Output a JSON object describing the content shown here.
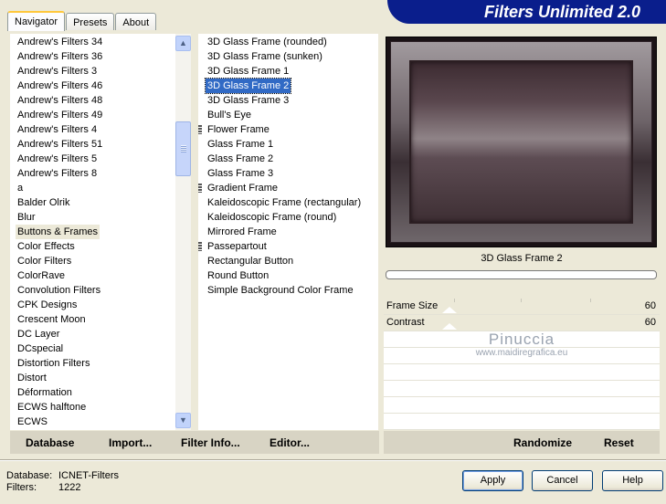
{
  "header": {
    "title": "Filters Unlimited 2.0"
  },
  "tabs": [
    {
      "label": "Navigator",
      "active": true
    },
    {
      "label": "Presets",
      "active": false
    },
    {
      "label": "About",
      "active": false
    }
  ],
  "categories": {
    "items": [
      "Andrew's Filters 34",
      "Andrew's Filters 36",
      "Andrew's Filters 3",
      "Andrew's Filters 46",
      "Andrew's Filters 48",
      "Andrew's Filters 49",
      "Andrew's Filters 4",
      "Andrew's Filters 51",
      "Andrew's Filters 5",
      "Andrew's Filters 8",
      "a",
      "Balder Olrik",
      "Blur",
      "Buttons & Frames",
      "Color Effects",
      "Color Filters",
      "ColorRave",
      "Convolution Filters",
      "CPK Designs",
      "Crescent Moon",
      "DC Layer",
      "DCspecial",
      "Distortion Filters",
      "Distort",
      "Déformation",
      "ECWS halftone",
      "ECWS"
    ],
    "selected": "Buttons & Frames"
  },
  "filters": {
    "items": [
      {
        "label": "3D Glass Frame (rounded)",
        "group": false
      },
      {
        "label": "3D Glass Frame (sunken)",
        "group": false
      },
      {
        "label": "3D Glass Frame 1",
        "group": false
      },
      {
        "label": "3D Glass Frame 2",
        "group": false
      },
      {
        "label": "3D Glass Frame 3",
        "group": false
      },
      {
        "label": "Bull's Eye",
        "group": false
      },
      {
        "label": "Flower Frame",
        "group": true
      },
      {
        "label": "Glass Frame 1",
        "group": false
      },
      {
        "label": "Glass Frame 2",
        "group": false
      },
      {
        "label": "Glass Frame 3",
        "group": false
      },
      {
        "label": "Gradient Frame",
        "group": true
      },
      {
        "label": "Kaleidoscopic Frame (rectangular)",
        "group": false
      },
      {
        "label": "Kaleidoscopic Frame (round)",
        "group": false
      },
      {
        "label": "Mirrored Frame",
        "group": false
      },
      {
        "label": "Passepartout",
        "group": true
      },
      {
        "label": "Rectangular Button",
        "group": false
      },
      {
        "label": "Round Button",
        "group": false
      },
      {
        "label": "Simple Background Color Frame",
        "group": false
      }
    ],
    "selected": "3D Glass Frame 2"
  },
  "preview": {
    "title": "3D Glass Frame 2"
  },
  "params": [
    {
      "label": "Frame Size",
      "value": "60",
      "fraction": 0.24
    },
    {
      "label": "Contrast",
      "value": "60",
      "fraction": 0.24
    }
  ],
  "watermark": {
    "line1": "Pinuccia",
    "line2": "www.maidiregrafica.eu"
  },
  "toolbar": {
    "database": "Database",
    "import": "Import...",
    "filter_info": "Filter Info...",
    "editor": "Editor...",
    "randomize": "Randomize",
    "reset": "Reset"
  },
  "status": {
    "database_label": "Database:",
    "database_value": "ICNET-Filters",
    "filters_label": "Filters:",
    "filters_value": "1222"
  },
  "buttons": {
    "apply": "Apply",
    "cancel": "Cancel",
    "help": "Help"
  },
  "colors": {
    "banner": "#0a1e8c",
    "highlight": "#316ac5",
    "tab_accent": "#ffc83c"
  },
  "icons": {
    "scroll_up": "arrow-up-icon",
    "scroll_down": "arrow-down-icon"
  }
}
